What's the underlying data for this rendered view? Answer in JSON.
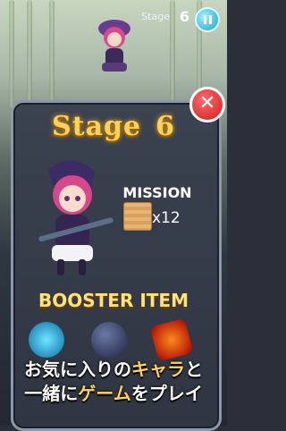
{
  "top_bar": {
    "stage_label": "Stage",
    "stage_number": "6"
  },
  "panel": {
    "title_word": "Stage",
    "title_number": "6",
    "mission_label": "MISSION",
    "mission_target_count": "x12",
    "booster_label": "BOOSTER ITEM"
  },
  "caption": {
    "line1_part1": "お気に入りの",
    "line1_part2": "キャラ",
    "line1_part3": "と",
    "line2_part1": "一緒に",
    "line2_part2": "ゲーム",
    "line2_part3": "をプレイ"
  },
  "colors": {
    "title": "#ffd15a",
    "close_button": "#d01d1d",
    "pause_button": "#1aa5c9"
  },
  "icons": {
    "pause": "pause-icon",
    "close": "close-icon",
    "crate": "wooden-crate-icon"
  }
}
